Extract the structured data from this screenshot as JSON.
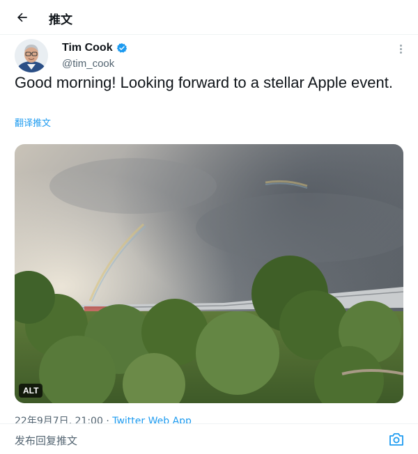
{
  "header": {
    "title": "推文",
    "back_icon": "arrow-left-icon"
  },
  "author": {
    "display_name": "Tim Cook",
    "handle": "@tim_cook",
    "verified_icon": "verified-badge-icon",
    "verified_color": "#1d9bf0",
    "more_icon": "more-vertical-icon"
  },
  "tweet": {
    "text": "Good morning! Looking forward to a stellar Apple event.",
    "translate_label": "翻译推文",
    "media_alt_badge": "ALT",
    "date": "22年9月7日, 21:00",
    "separator": "·",
    "client": "Twitter Web App"
  },
  "reply": {
    "placeholder": "发布回复推文",
    "camera_icon": "camera-icon"
  },
  "colors": {
    "accent": "#1d9bf0",
    "text": "#0f1419",
    "secondary": "#536471"
  }
}
